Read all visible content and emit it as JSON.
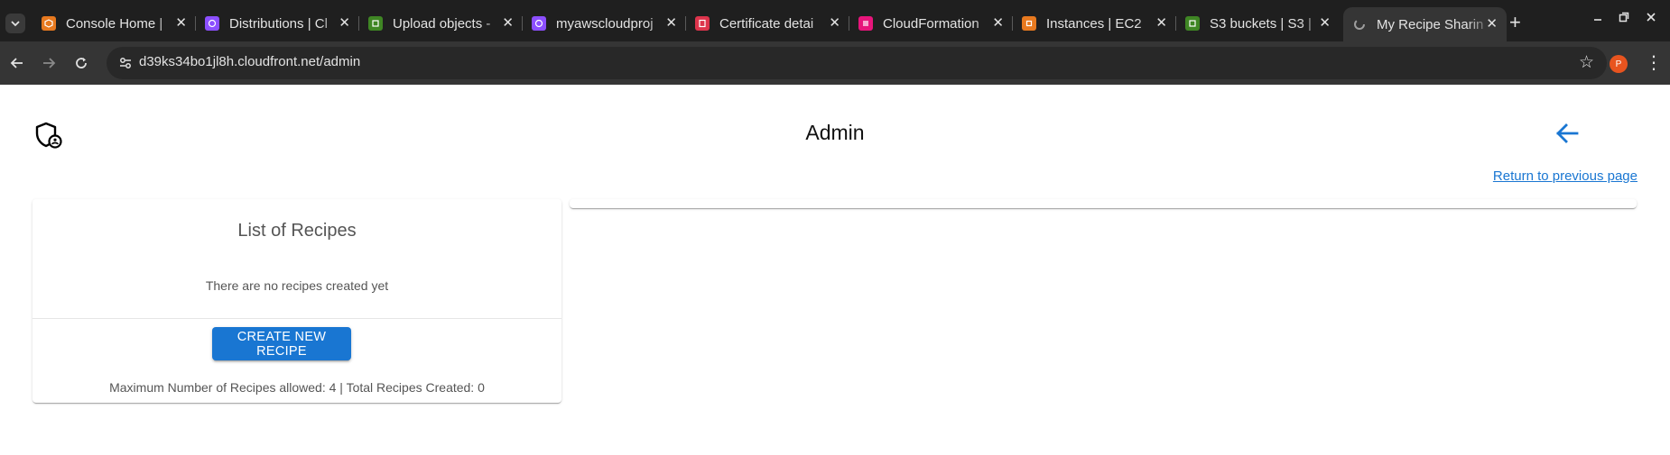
{
  "browser": {
    "tabs": [
      {
        "title": "Console Home |",
        "icon": "aws-console-icon",
        "color": "#e7791f"
      },
      {
        "title": "Distributions | Cl",
        "icon": "cloudfront-icon",
        "color": "#8c4fff"
      },
      {
        "title": "Upload objects -",
        "icon": "s3-icon",
        "color": "#3f8624"
      },
      {
        "title": "myawscloudproj",
        "icon": "cloudfront-icon",
        "color": "#8c4fff"
      },
      {
        "title": "Certificate detai",
        "icon": "acm-icon",
        "color": "#dd344c"
      },
      {
        "title": "CloudFormation",
        "icon": "cloudformation-icon",
        "color": "#e7157b"
      },
      {
        "title": "Instances | EC2",
        "icon": "ec2-icon",
        "color": "#e7791f"
      },
      {
        "title": "S3 buckets | S3 |",
        "icon": "s3-icon",
        "color": "#3f8624"
      },
      {
        "title": "My Recipe Sharin",
        "icon": "spinner-icon",
        "color": "#9e9e9e"
      }
    ],
    "new_tab_glyph": "+",
    "url": "d39ks34bo1jl8h.cloudfront.net/admin",
    "profile_initial": "P"
  },
  "page": {
    "title": "Admin",
    "return_link": "Return to previous page",
    "accent_color": "#1976d2",
    "recipes_card": {
      "title": "List of Recipes",
      "empty_message": "There are no recipes created yet",
      "create_button": "CREATE NEW RECIPE",
      "quota_text": "Maximum Number of Recipes allowed: 4 | Total Recipes Created: 0"
    }
  }
}
